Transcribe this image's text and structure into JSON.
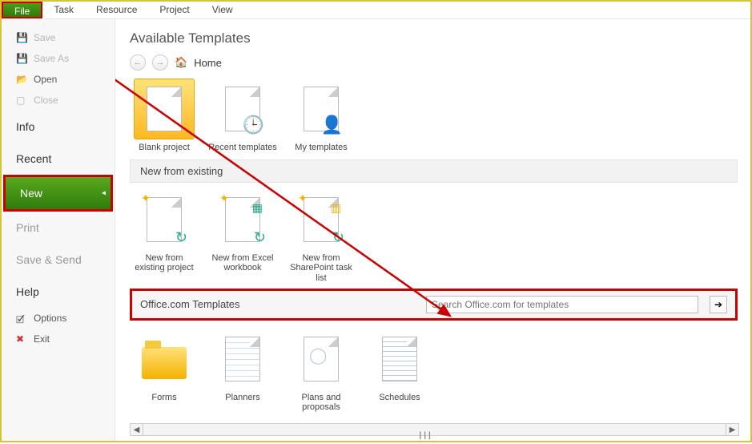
{
  "menu": {
    "file": "File",
    "task": "Task",
    "resource": "Resource",
    "project": "Project",
    "view": "View"
  },
  "side": {
    "save": "Save",
    "saveas": "Save As",
    "open": "Open",
    "close": "Close",
    "info": "Info",
    "recent": "Recent",
    "new": "New",
    "print": "Print",
    "savesend": "Save & Send",
    "help": "Help",
    "options": "Options",
    "exit": "Exit"
  },
  "title": "Available Templates",
  "crumb_home": "Home",
  "tiles1": [
    {
      "label": "Blank project"
    },
    {
      "label": "Recent templates"
    },
    {
      "label": "My templates"
    }
  ],
  "section1": "New from existing",
  "tiles2": [
    {
      "label": "New from existing project"
    },
    {
      "label": "New from Excel workbook"
    },
    {
      "label": "New from SharePoint task list"
    }
  ],
  "office_label": "Office.com Templates",
  "search_placeholder": "Search Office.com for templates",
  "tiles3": [
    {
      "label": "Forms"
    },
    {
      "label": "Planners"
    },
    {
      "label": "Plans and proposals"
    },
    {
      "label": "Schedules"
    }
  ]
}
